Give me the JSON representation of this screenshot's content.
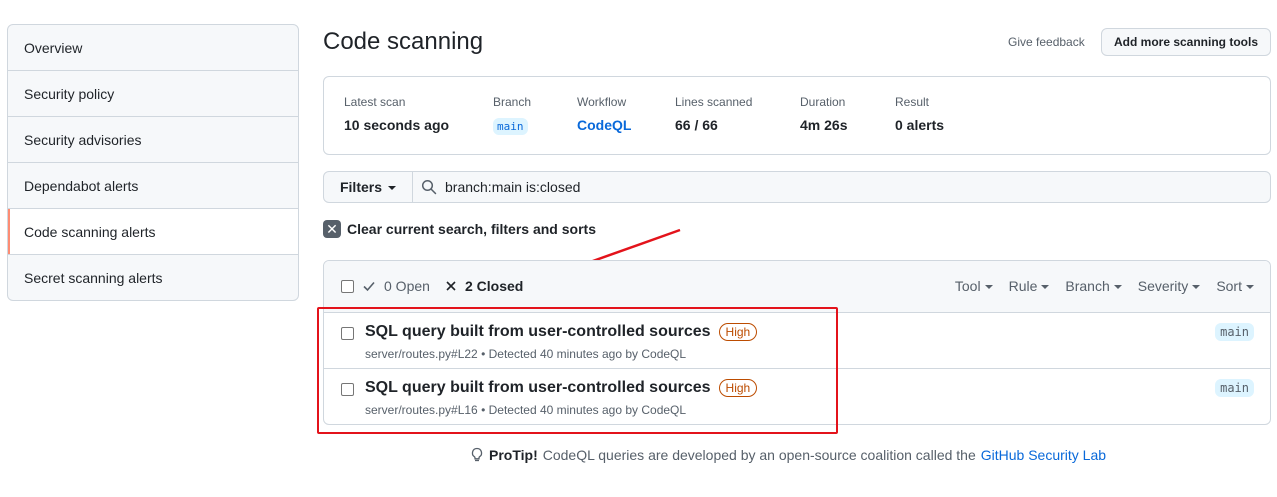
{
  "sidebar": {
    "items": [
      {
        "label": "Overview"
      },
      {
        "label": "Security policy"
      },
      {
        "label": "Security advisories"
      },
      {
        "label": "Dependabot alerts"
      },
      {
        "label": "Code scanning alerts"
      },
      {
        "label": "Secret scanning alerts"
      }
    ],
    "active_index": 4,
    "active_accent": "#fd8c73"
  },
  "header": {
    "title": "Code scanning",
    "feedback": "Give feedback",
    "add_tools": "Add more scanning tools"
  },
  "scan": {
    "latest_scan": {
      "label": "Latest scan",
      "value": "10 seconds ago"
    },
    "branch": {
      "label": "Branch",
      "value": "main"
    },
    "workflow": {
      "label": "Workflow",
      "value": "CodeQL"
    },
    "lines": {
      "label": "Lines scanned",
      "value": "66 / 66"
    },
    "duration": {
      "label": "Duration",
      "value": "4m 26s"
    },
    "result": {
      "label": "Result",
      "value": "0 alerts"
    }
  },
  "filters": {
    "button": "Filters",
    "query": "branch:main is:closed",
    "clear": "Clear current search, filters and sorts"
  },
  "alerts": {
    "open_label": "0 Open",
    "closed_label": "2 Closed",
    "menus": [
      "Tool",
      "Rule",
      "Branch",
      "Severity",
      "Sort"
    ],
    "rows": [
      {
        "title": "SQL query built from user-controlled sources",
        "severity": "High",
        "meta": "server/routes.py#L22 • Detected 40 minutes ago by CodeQL",
        "branch": "main"
      },
      {
        "title": "SQL query built from user-controlled sources",
        "severity": "High",
        "meta": "server/routes.py#L16 • Detected 40 minutes ago by CodeQL",
        "branch": "main"
      }
    ]
  },
  "protip": {
    "label": "ProTip!",
    "text": "CodeQL queries are developed by an open-source coalition called the",
    "link": "GitHub Security Lab"
  },
  "annotation_color": "#e3131b"
}
